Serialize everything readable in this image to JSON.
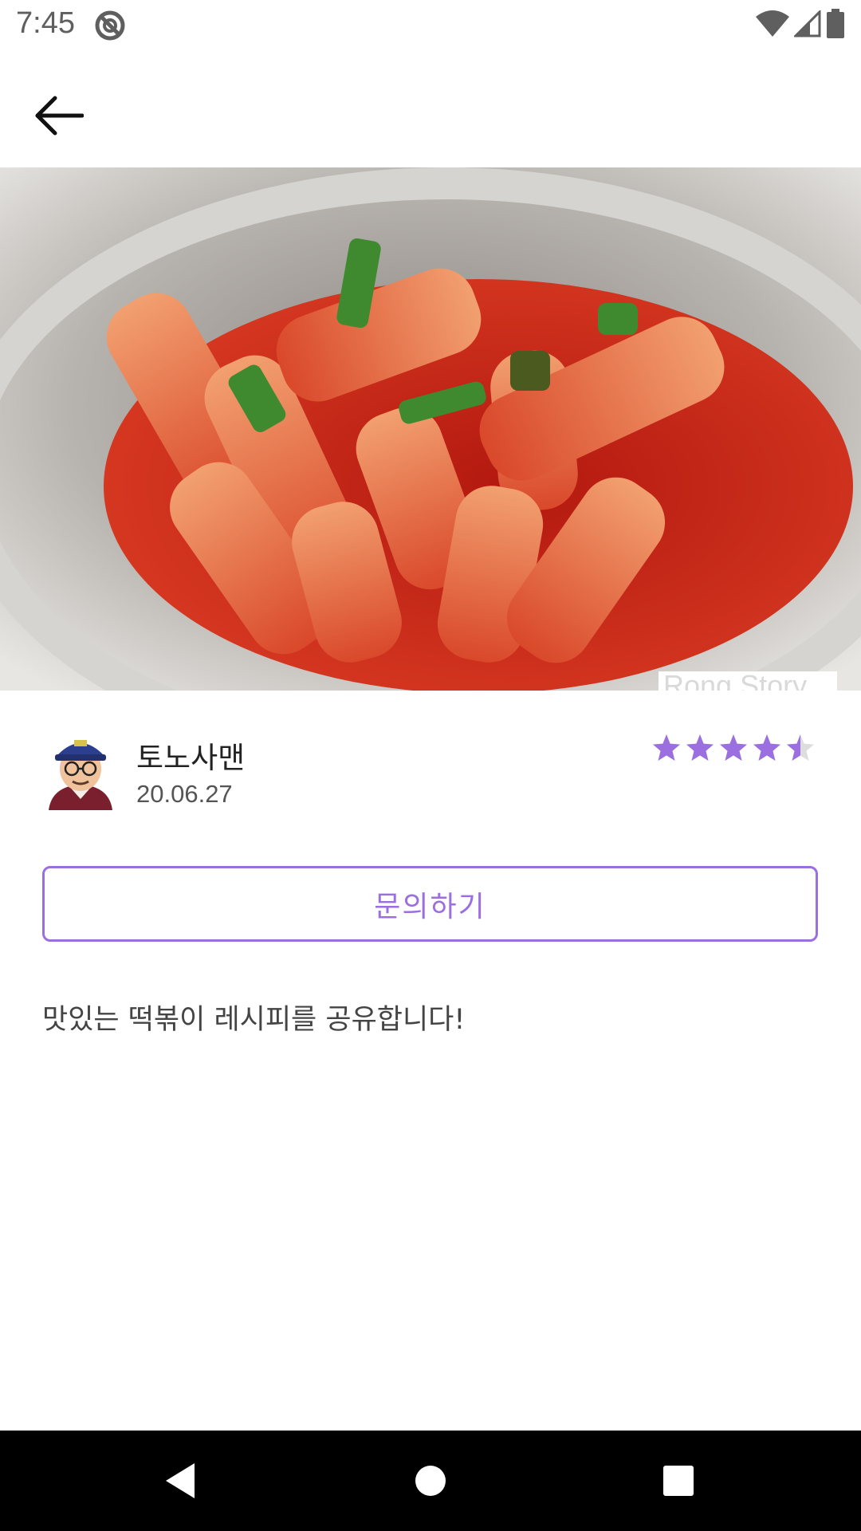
{
  "status_bar": {
    "time": "7:45",
    "icons": [
      "do-not-disturb-icon",
      "wifi-icon",
      "cellular-signal-icon",
      "battery-icon"
    ]
  },
  "app_bar": {
    "back_icon": "arrow-left-icon"
  },
  "post": {
    "image_watermark": "Rong Story",
    "author_name": "토노사맨",
    "date": "20.06.27",
    "rating": 4.5,
    "rating_max": 5,
    "inquiry_label": "문의하기",
    "description": "맛있는 떡볶이 레시피를 공유합니다!"
  },
  "nav_bar": {
    "icons": [
      "nav-back-icon",
      "nav-home-icon",
      "nav-recents-icon"
    ]
  },
  "colors": {
    "accent": "#9b6fe0",
    "star_filled": "#9b6fe0",
    "star_empty": "#dddddd"
  }
}
